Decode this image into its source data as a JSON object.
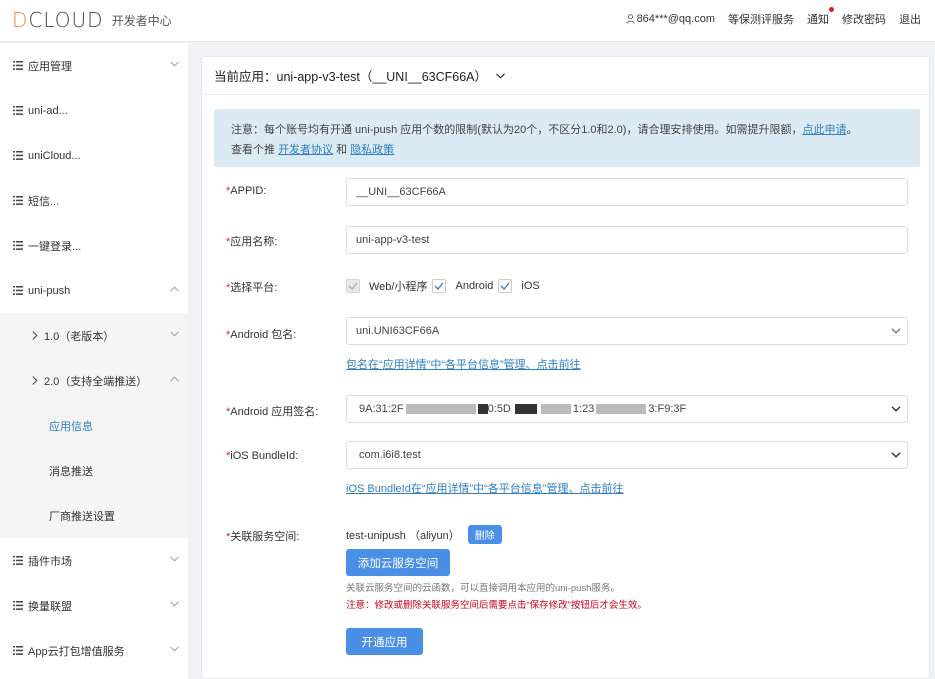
{
  "header": {
    "logo_text": "DCLOUD",
    "logo_sub": "开发者中心",
    "user_email": "864***@qq.com",
    "nav": [
      "等保测评服务",
      "通知",
      "修改密码",
      "退出"
    ]
  },
  "sidebar": {
    "items": [
      {
        "label": "应用管理"
      },
      {
        "label": "uni-ad..."
      },
      {
        "label": "uniCloud..."
      },
      {
        "label": "短信..."
      },
      {
        "label": "一键登录..."
      },
      {
        "label": "uni-push"
      },
      {
        "label": "1.0（老版本）"
      },
      {
        "label": "2.0（支持全端推送）"
      },
      {
        "label": "应用信息"
      },
      {
        "label": "消息推送"
      },
      {
        "label": "厂商推送设置"
      },
      {
        "label": "插件市场"
      },
      {
        "label": "换量联盟"
      },
      {
        "label": "App云打包增值服务"
      }
    ]
  },
  "main": {
    "current_app": "当前应用：uni-app-v3-test（__UNI__63CF66A）",
    "notice": {
      "text1": "注意：每个账号均有开通 uni-push 应用个数的限制(默认为20个，不区分1.0和2.0)，请合理安排使用。如需提升限额，",
      "link1": "点此申请",
      "text1_end": "。",
      "text2": "查看个推 ",
      "link2": "开发者协议",
      "text2_mid": " 和 ",
      "link3": "隐私政策"
    },
    "form": {
      "req": "*",
      "appid_label": "APPID:",
      "appid_value": "__UNI__63CF66A",
      "name_label": "应用名称:",
      "name_value": "uni-app-v3-test",
      "platform_label": "选择平台:",
      "platforms": [
        "Web/小程序",
        "Android",
        "iOS"
      ],
      "android_pkg_label": "Android 包名:",
      "android_pkg_value": "uni.UNI63CF66A",
      "android_pkg_link": "包名在“应用详情”中“各平台信息”管理、点击前往",
      "android_sign_label": "Android 应用签名:",
      "android_sign_parts": [
        "9A:31:2F",
        "0:5D",
        "1:23",
        "3:F9:3F"
      ],
      "ios_label": "iOS BundleId:",
      "ios_value": "com.i6i8.test",
      "ios_link": "iOS BundleId在“应用详情”中“各平台信息”管理、点击前往",
      "space_label": "关联服务空间:",
      "space_value": "test-unipush （aliyun）",
      "delete_label": "删除",
      "add_space_label": "添加云服务空间",
      "hint1": "关联云服务空间的云函数，可以直接调用本应用的uni-push服务。",
      "hint2": "注意：修改或删除关联服务空间后需要点击“保存修改”按钮后才会生效。",
      "submit_label": "开通应用"
    }
  }
}
